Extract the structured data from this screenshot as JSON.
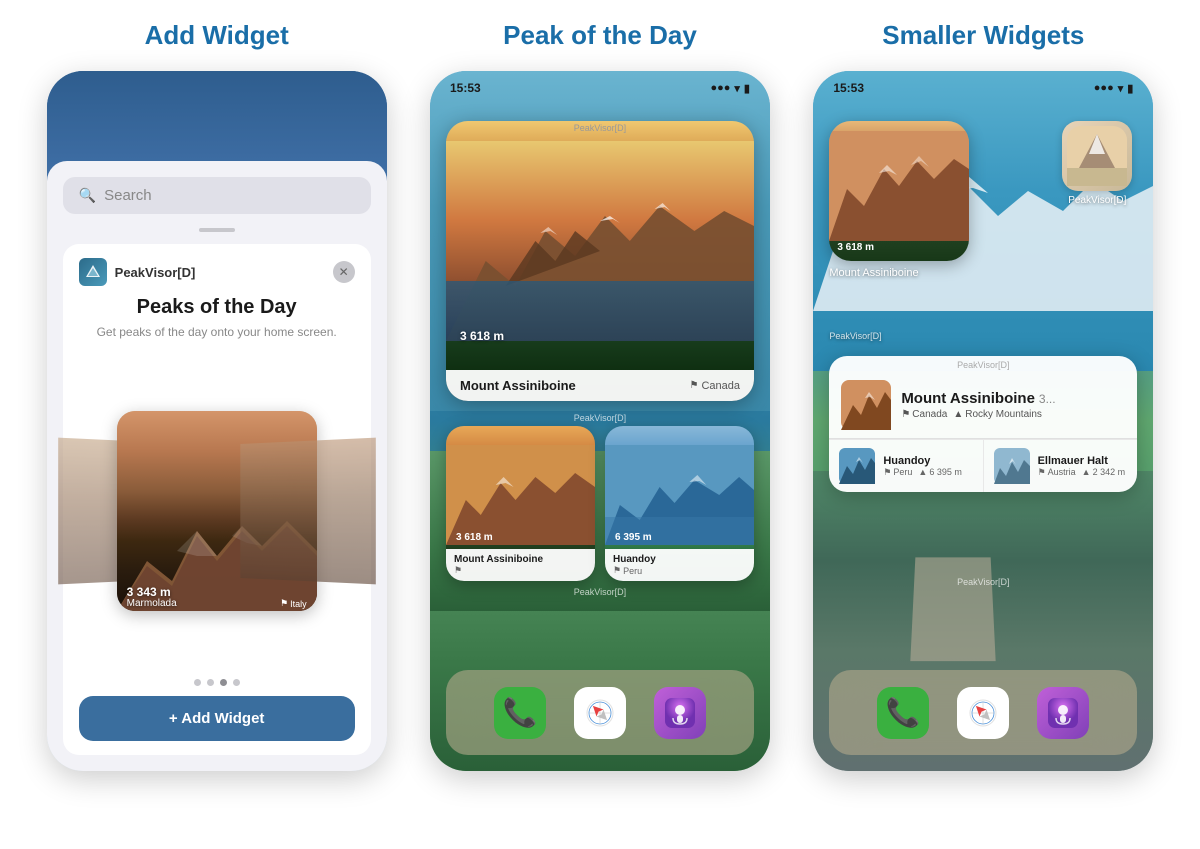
{
  "sections": [
    {
      "id": "add-widget",
      "title": "Add Widget",
      "panel": {
        "search_placeholder": "Search",
        "app_name": "PeakVisor[D]",
        "widget_title": "Peaks of the Day",
        "widget_desc": "Get peaks of the day onto your home screen.",
        "peak_name": "Marmolada",
        "peak_altitude": "3 343 m",
        "peak_country": "Italy",
        "add_button": "+ Add Widget",
        "dots": [
          false,
          false,
          true,
          false
        ]
      }
    },
    {
      "id": "peak-of-day",
      "title": "Peak of the Day",
      "panel": {
        "time": "15:53",
        "app_label": "PeakVisor[D]",
        "large_widget": {
          "peak_name": "Mount Assiniboine",
          "altitude": "3 618 m",
          "country": "Canada"
        },
        "small_widgets": [
          {
            "peak_name": "Mount Assiniboine",
            "altitude": "3 618 m",
            "country": ""
          },
          {
            "peak_name": "Huandoy",
            "altitude": "6 395 m",
            "country": "Peru"
          }
        ],
        "dock": [
          "Phone",
          "Safari",
          "Podcasts"
        ]
      }
    },
    {
      "id": "smaller-widgets",
      "title": "Smaller Widgets",
      "panel": {
        "time": "15:53",
        "app_label": "PeakVisor[D]",
        "sq_widget": {
          "altitude": "3 618 m",
          "peak_name": "Mount Assiniboine"
        },
        "app_icon_label": "PeakVisor[D]",
        "app_label_footer": "PeakVisor[D]",
        "medium_widget": {
          "main_peak": {
            "name": "Mount Assiniboine",
            "altitude": "3...",
            "country": "Canada",
            "region": "Rocky Mountains"
          },
          "peaks": [
            {
              "name": "Huandoy",
              "country": "Peru",
              "altitude": "6 395 m"
            },
            {
              "name": "Ellmauer Halt",
              "country": "Austria",
              "altitude": "2 342 m"
            }
          ]
        },
        "dock": [
          "Phone",
          "Safari",
          "Podcasts"
        ]
      }
    }
  ],
  "colors": {
    "title_blue": "#1a6ea8",
    "widget_btn_bg": "#3a6e9e",
    "phone_bg_green": "#4a8860"
  }
}
